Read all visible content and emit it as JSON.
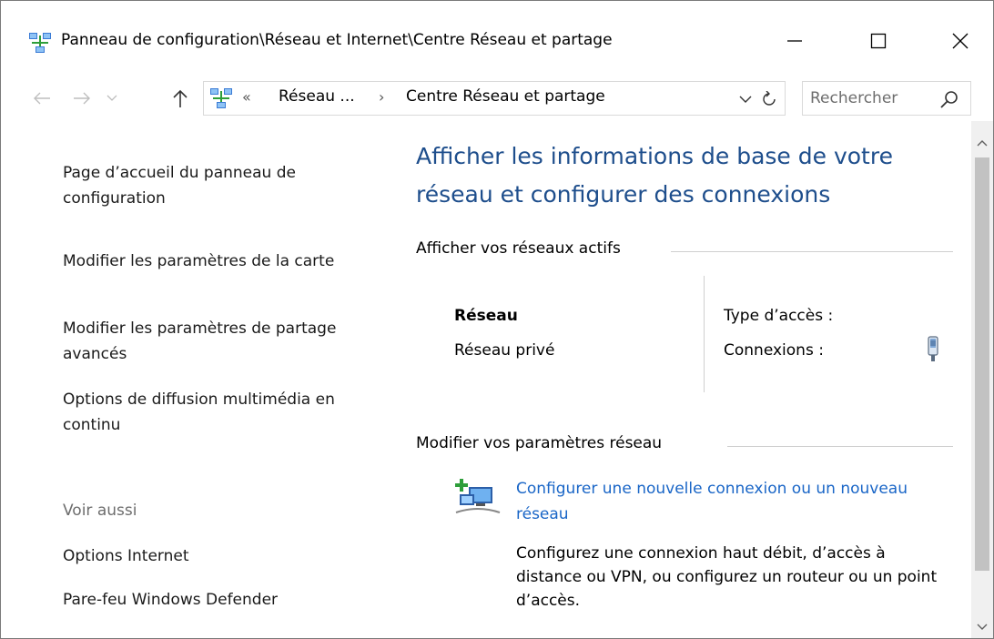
{
  "window": {
    "title": "Panneau de configuration\\Réseau et Internet\\Centre Réseau et partage",
    "icon": "network-sharing-center-icon"
  },
  "nav": {
    "back_icon": "arrow-left-icon",
    "forward_icon": "arrow-right-icon",
    "recent_icon": "chevron-down-icon",
    "up_icon": "arrow-up-icon"
  },
  "address": {
    "overflow_chevron": "«",
    "crumbs": [
      "Réseau ...",
      "Centre Réseau et partage"
    ],
    "separator": "›"
  },
  "search": {
    "placeholder": "Rechercher"
  },
  "sidebar": {
    "links": [
      "Page d’accueil du panneau de configuration",
      "Modifier les paramètres de la carte",
      "Modifier les paramètres de partage avancés",
      "Options de diffusion multimédia en continu"
    ],
    "see_also_label": "Voir aussi",
    "see_also_links": [
      "Options Internet",
      "Pare-feu Windows Defender"
    ]
  },
  "main": {
    "title": "Afficher les informations de base de votre réseau et configurer des connexions",
    "active_networks_heading": "Afficher vos réseaux actifs",
    "network": {
      "name": "Réseau",
      "type": "Réseau privé",
      "access_type_label": "Type d’accès :",
      "connections_label": "Connexions :"
    },
    "change_settings_heading": "Modifier vos paramètres réseau",
    "setup": {
      "link": "Configurer une nouvelle connexion ou un nouveau réseau",
      "description": "Configurez une connexion haut débit, d’accès à distance ou VPN, ou configurez un routeur ou un point d’accès."
    }
  },
  "colors": {
    "title_blue": "#1e4e8c",
    "link_blue": "#1a66c7",
    "muted_gray": "#6d6d6d"
  }
}
